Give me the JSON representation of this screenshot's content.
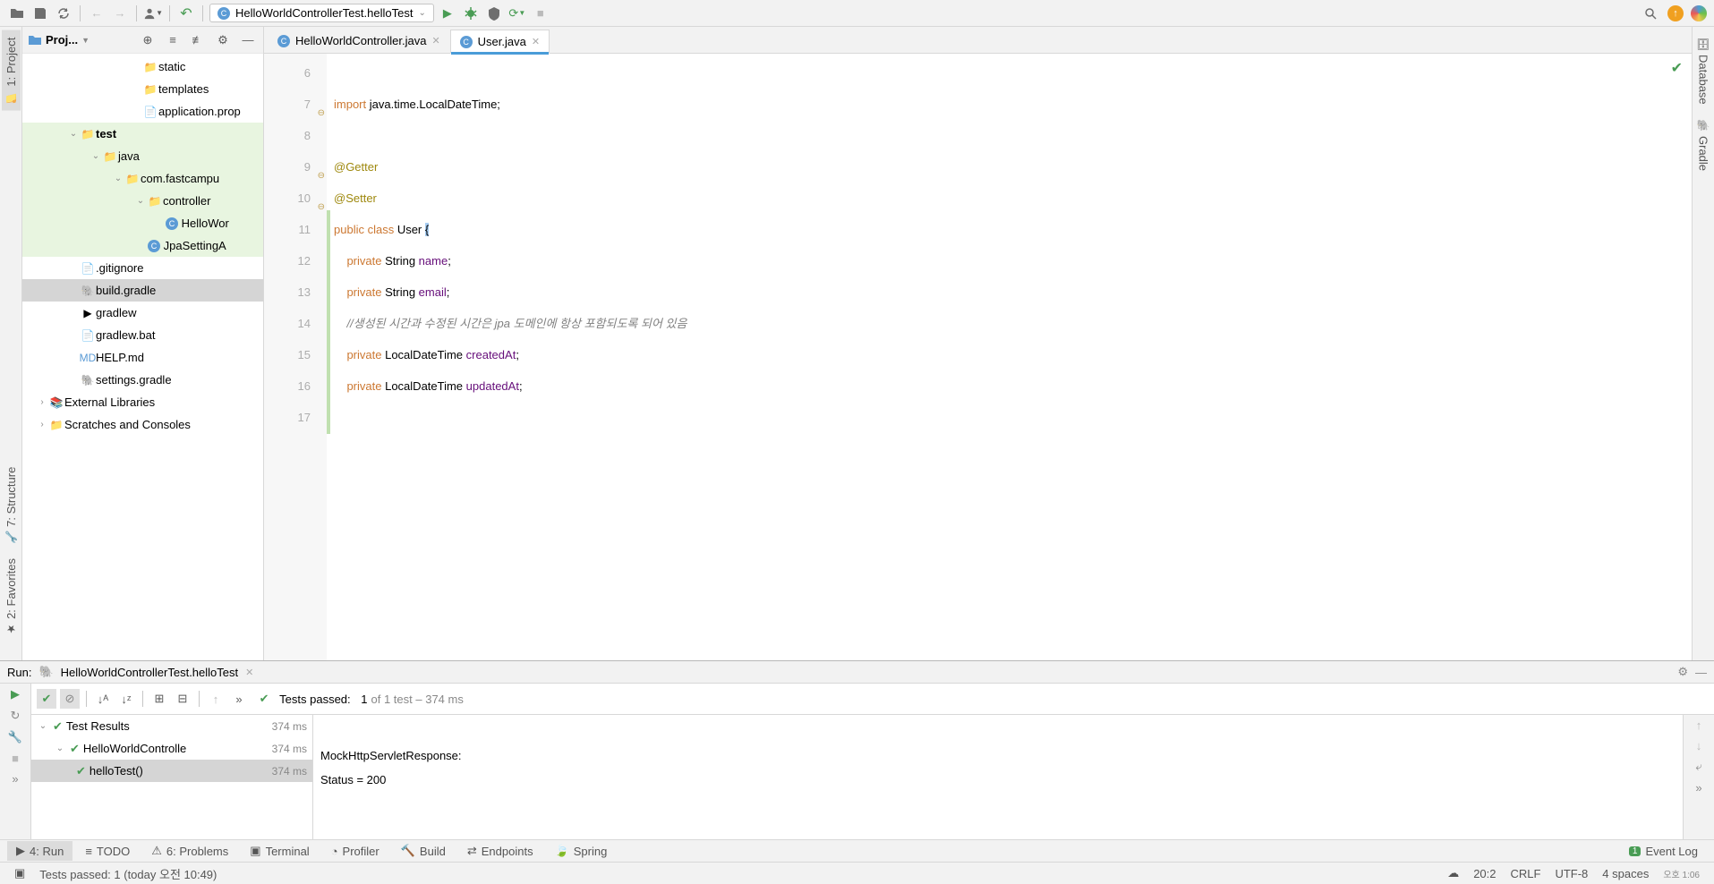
{
  "toolbar": {
    "run_config": "HelloWorldControllerTest.helloTest"
  },
  "left_stripe": {
    "project": "1: Project",
    "structure": "7: Structure",
    "favorites": "2: Favorites"
  },
  "right_stripe": {
    "database": "Database",
    "gradle": "Gradle"
  },
  "project_panel": {
    "title": "Proj...",
    "nodes": {
      "static": "static",
      "templates": "templates",
      "application_props": "application.prop",
      "test": "test",
      "java": "java",
      "pkg": "com.fastcampu",
      "controller": "controller",
      "hello": "HelloWor",
      "jpa": "JpaSettingA",
      "gitignore": ".gitignore",
      "build_gradle": "build.gradle",
      "gradlew": "gradlew",
      "gradlew_bat": "gradlew.bat",
      "help_md": "HELP.md",
      "settings_gradle": "settings.gradle",
      "ext_libs": "External Libraries",
      "scratches": "Scratches and Consoles"
    }
  },
  "tabs": [
    {
      "file": "HelloWorldController.java",
      "active": false
    },
    {
      "file": "User.java",
      "active": true
    }
  ],
  "code_lines": [
    {
      "n": 6,
      "txt": ""
    },
    {
      "n": 7,
      "txt": "import java.time.LocalDateTime;",
      "k": "import"
    },
    {
      "n": 8,
      "txt": ""
    },
    {
      "n": 9,
      "txt": "@Getter",
      "anno": true
    },
    {
      "n": 10,
      "txt": "@Setter",
      "anno": true
    },
    {
      "n": 11,
      "txt": "public class User {"
    },
    {
      "n": 12,
      "txt": "    private String name;"
    },
    {
      "n": 13,
      "txt": "    private String email;"
    },
    {
      "n": 14,
      "txt": "    //생성된 시간과 수정된 시간은 jpa 도메인에 항상 포함되도록 되어 있음",
      "comment": true
    },
    {
      "n": 15,
      "txt": "    private LocalDateTime createdAt;"
    },
    {
      "n": 16,
      "txt": "    private LocalDateTime updatedAt;"
    },
    {
      "n": 17,
      "txt": ""
    }
  ],
  "run": {
    "title": "Run:",
    "config": "HelloWorldControllerTest.helloTest",
    "status_prefix": "Tests passed:",
    "passed": "1",
    "status_suffix": " of 1 test – 374 ms",
    "tree": {
      "root": "Test Results",
      "root_time": "374 ms",
      "suite": "HelloWorldControlle",
      "suite_time": "374 ms",
      "test": "helloTest()",
      "test_time": "374 ms"
    },
    "output": {
      "l1": "MockHttpServletResponse:",
      "l2": "           Status = 200"
    }
  },
  "bottom_tabs": {
    "run": "4: Run",
    "todo": "TODO",
    "problems": "6: Problems",
    "terminal": "Terminal",
    "profiler": "Profiler",
    "build": "Build",
    "endpoints": "Endpoints",
    "spring": "Spring",
    "event_log": "Event Log"
  },
  "status": {
    "msg": "Tests passed: 1 (today 오전 10:49)",
    "pos": "20:2",
    "sep": "CRLF",
    "enc": "UTF-8",
    "indent": "4 spaces",
    "time": "오호 1:06"
  }
}
